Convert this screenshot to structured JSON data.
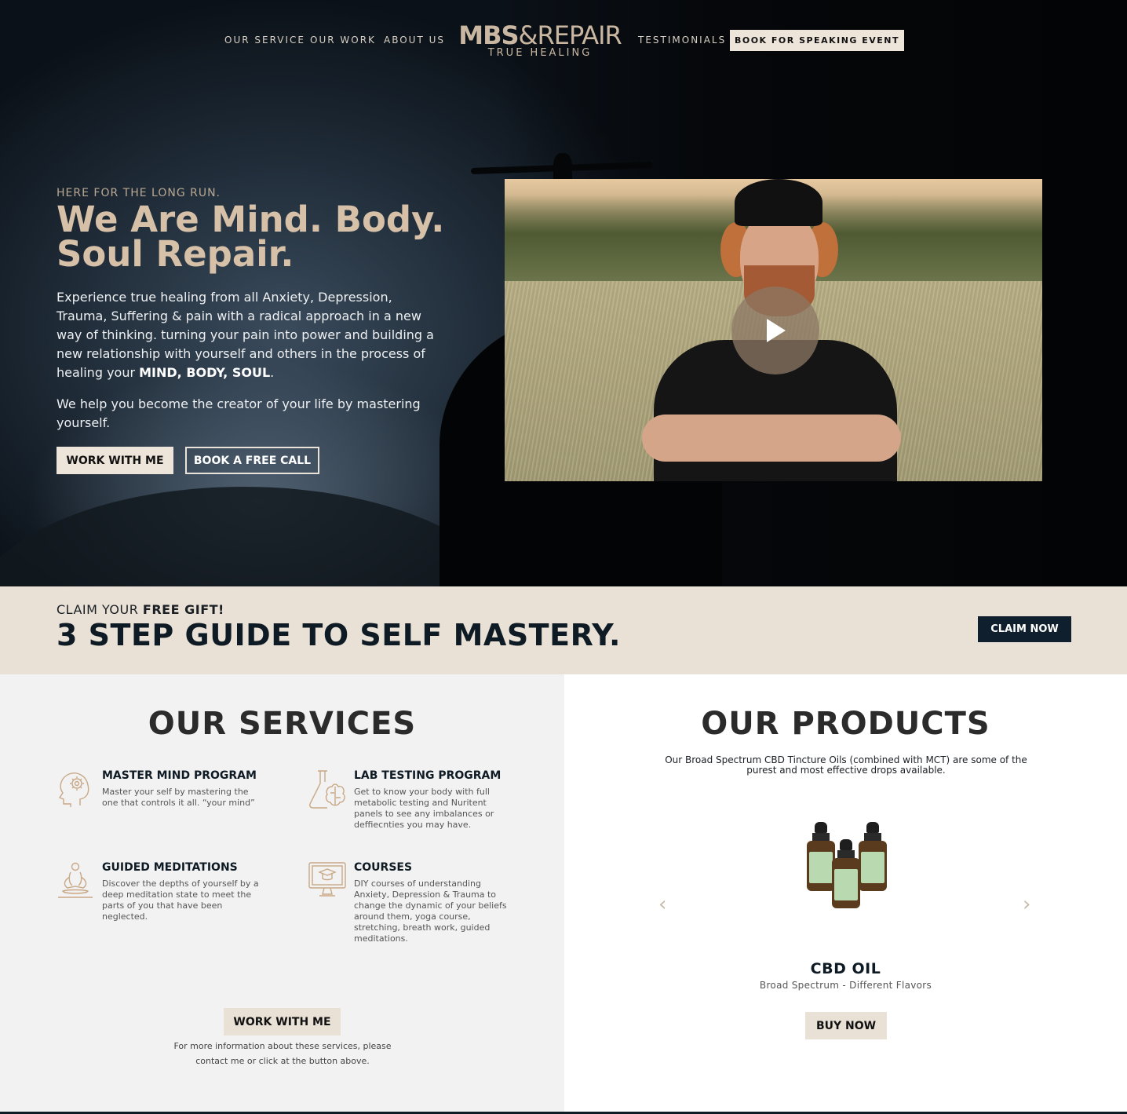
{
  "nav": {
    "links_left": [
      "OUR SERVICE",
      "OUR WORK",
      "ABOUT US"
    ],
    "logo_main_bold": "MBS",
    "logo_amp": "&",
    "logo_main_light": "REPAIR",
    "logo_sub": "TRUE HEALING",
    "links_right": [
      "TESTIMONIALS"
    ],
    "cta": "BOOK FOR SPEAKING EVENT"
  },
  "hero": {
    "eyebrow": "HERE FOR THE LONG RUN.",
    "title": "We Are Mind. Body. Soul Repair.",
    "p1_text": "Experience true healing from all Anxiety, Depression, Trauma, Suffering & pain with a radical approach in a new way of thinking. turning your pain into power and building a new relationship with yourself and others in the process of healing your ",
    "p1_bold": "MIND, BODY, SOUL",
    "p1_end": ".",
    "p2": "We help you become the creator of your life by mastering yourself.",
    "btn_primary": "WORK WITH ME",
    "btn_outline": "BOOK A FREE CALL",
    "video_icon": "play-icon"
  },
  "gift": {
    "eyebrow_text": "CLAIM YOUR ",
    "eyebrow_bold": "FREE GIFT!",
    "title": "3 STEP GUIDE TO SELF MASTERY.",
    "button": "CLAIM NOW"
  },
  "services": {
    "title": "OUR SERVICES",
    "items": [
      {
        "title": "MASTER MIND PROGRAM",
        "desc": "Master your self by mastering the one that controls it all. “your mind”",
        "icon": "mind-gear-icon"
      },
      {
        "title": "LAB TESTING PROGRAM",
        "desc": "Get to know your body with full metabolic testing and Nuritent panels to see any imbalances or deffiecnties you may have.",
        "icon": "flask-brain-icon"
      },
      {
        "title": "GUIDED MEDITATIONS",
        "desc": "Discover the depths of yourself by a deep meditation state to meet the parts of you that have been neglected.",
        "icon": "meditation-icon"
      },
      {
        "title": "COURSES",
        "desc": "DIY courses of understanding Anxiety, Depression & Trauma to change the dynamic of your beliefs around them, yoga course, stretching, breath work, guided meditations.",
        "icon": "online-course-icon"
      }
    ],
    "button": "WORK WITH ME",
    "note": "For more information about these services, please contact me or click at the button above."
  },
  "products": {
    "title": "OUR PRODUCTS",
    "desc": "Our Broad Spectrum CBD Tincture Oils (combined with MCT) are some of the purest and most effective drops available.",
    "product_name": "CBD OIL",
    "product_sub": "Broad Spectrum - Different Flavors",
    "button": "BUY NOW",
    "prev_arrow": "‹",
    "next_arrow": "›"
  },
  "colors": {
    "accent_beige": "#e9e1d6",
    "title_gold": "#d6c1a8",
    "navy": "#0f1f2e"
  }
}
